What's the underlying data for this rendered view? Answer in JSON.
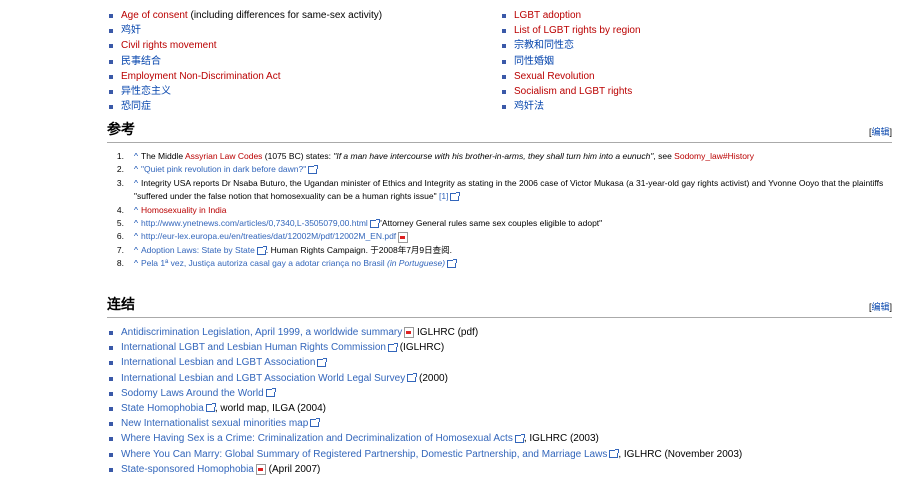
{
  "see_also": {
    "left": [
      {
        "link": "Age of consent",
        "suffix": " (including differences for same-sex activity)",
        "color": "red"
      },
      {
        "link": "鸡奸",
        "suffix": "",
        "color": "blue"
      },
      {
        "link": "Civil rights movement",
        "suffix": "",
        "color": "red"
      },
      {
        "link": "民事结合",
        "suffix": "",
        "color": "blue"
      },
      {
        "link": "Employment Non-Discrimination Act",
        "suffix": "",
        "color": "red"
      },
      {
        "link": "异性恋主义",
        "suffix": "",
        "color": "blue"
      },
      {
        "link": "恐同症",
        "suffix": "",
        "color": "blue"
      }
    ],
    "right": [
      {
        "link": "LGBT adoption",
        "suffix": "",
        "color": "red"
      },
      {
        "link": "List of LGBT rights by region",
        "suffix": "",
        "color": "red"
      },
      {
        "link": "宗教和同性恋",
        "suffix": "",
        "color": "blue"
      },
      {
        "link": "同性婚姻",
        "suffix": "",
        "color": "blue"
      },
      {
        "link": "Sexual Revolution",
        "suffix": "",
        "color": "red"
      },
      {
        "link": "Socialism and LGBT rights",
        "suffix": "",
        "color": "red"
      },
      {
        "link": "鸡奸法",
        "suffix": "",
        "color": "blue"
      }
    ]
  },
  "references": {
    "heading": "参考",
    "edit_open": "[",
    "edit_label": "编辑",
    "edit_close": "]",
    "caret": "^",
    "items": [
      {
        "num": "1.",
        "parts": [
          {
            "t": "The Middle ",
            "s": ""
          },
          {
            "t": "Assyrian Law Codes",
            "s": "red"
          },
          {
            "t": " (1075 BC) states: ",
            "s": ""
          },
          {
            "t": "\"If a man have intercourse with his brother-in-arms, they shall turn him into a eunuch\"",
            "s": "i"
          },
          {
            "t": ", see ",
            "s": ""
          },
          {
            "t": "Sodomy_law#History",
            "s": "red"
          }
        ]
      },
      {
        "num": "2.",
        "parts": [
          {
            "t": "\"Quiet pink revolution in dark before dawn?",
            "s": "ext"
          },
          {
            "t": "\"",
            "s": "ext",
            "icon": true
          }
        ]
      },
      {
        "num": "3.",
        "parts": [
          {
            "t": "Integrity USA reports Dr Nsaba Buturo, the Ugandan minister of Ethics and Integrity as stating in the 2006 case of Victor Mukasa (a 31-year-old gay rights activist) and Yvonne Ooyo that the plaintiffs \"suffered under the false notion that homosexuality can be a human rights issue\" ",
            "s": ""
          },
          {
            "t": "[1]",
            "s": "ext",
            "icon": true
          }
        ]
      },
      {
        "num": "4.",
        "parts": [
          {
            "t": "Homosexuality in India",
            "s": "red"
          }
        ]
      },
      {
        "num": "5.",
        "parts": [
          {
            "t": "http://www.ynetnews.com/articles/0,7340,L-3505079,00.html",
            "s": "ext",
            "icon": true
          },
          {
            "t": "\"Attorney General rules same sex couples eligible to adopt\"",
            "s": ""
          }
        ]
      },
      {
        "num": "6.",
        "parts": [
          {
            "t": "http://eur-lex.europa.eu/en/treaties/dat/12002M/pdf/12002M_EN.pdf",
            "s": "ext",
            "pdf": true
          }
        ]
      },
      {
        "num": "7.",
        "parts": [
          {
            "t": "Adoption Laws: State by State",
            "s": "ext",
            "icon": true
          },
          {
            "t": ". Human Rights Campaign. 于2008年7月9日查阅.",
            "s": ""
          }
        ]
      },
      {
        "num": "8.",
        "parts": [
          {
            "t": "Pela 1ª vez, Justiça autoriza casal gay a adotar criança no Brasil ",
            "s": "ext"
          },
          {
            "t": "(in Portuguese)",
            "s": "ext i",
            "icon": true
          }
        ]
      }
    ]
  },
  "links_section": {
    "heading": "连结",
    "edit_open": "[",
    "edit_label": "编辑",
    "edit_close": "]",
    "items": [
      {
        "link": "Antidiscrimination Legislation, April 1999, a worldwide summary",
        "icon": "pdf",
        "suffix": " IGLHRC (pdf)"
      },
      {
        "link": "International LGBT and Lesbian Human Rights Commission",
        "icon": "ext",
        "suffix": " (IGLHRC)"
      },
      {
        "link": "International Lesbian and LGBT Association",
        "icon": "ext",
        "suffix": ""
      },
      {
        "link": "International Lesbian and LGBT Association World Legal Survey",
        "icon": "ext",
        "suffix": " (2000)"
      },
      {
        "link": "Sodomy Laws Around the World",
        "icon": "ext",
        "suffix": ""
      },
      {
        "link": "State Homophobia",
        "icon": "ext",
        "suffix": ", world map, ILGA (2004)"
      },
      {
        "link": "New Internationalist sexual minorities map",
        "icon": "ext",
        "suffix": ""
      },
      {
        "link": "Where Having Sex is a Crime: Criminalization and Decriminalization of Homosexual Acts",
        "icon": "ext",
        "suffix": ", IGLHRC (2003)"
      },
      {
        "link": "Where You Can Marry: Global Summary of Registered Partnership, Domestic Partnership, and Marriage Laws",
        "icon": "ext",
        "suffix": ", IGLHRC (November 2003)"
      },
      {
        "link": "State-sponsored Homophobia",
        "icon": "pdf",
        "suffix": " (April 2007)"
      }
    ]
  }
}
